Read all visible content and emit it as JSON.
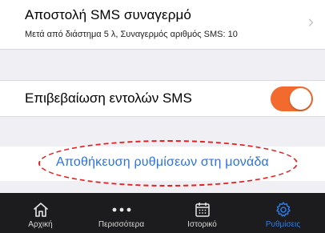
{
  "alarm_sms": {
    "title": "Αποστολή SMS συναγερμό",
    "subtitle": "Μετά από διάστημα 5 λ, Συναγερμός αριθμός SMS: 10",
    "chevron_icon": "chevron-right-icon"
  },
  "confirm_sms": {
    "label": "Επιβεβαίωση εντολών SMS",
    "toggle_on": true,
    "toggle_color": "#f26a2e"
  },
  "save": {
    "label": "Αποθήκευση ρυθμίσεων στη μονάδα",
    "link_color": "#2b72e0",
    "highlight_color": "#e42020"
  },
  "tabbar": {
    "active_color": "#2c7be5",
    "items": [
      {
        "label": "Αρχική",
        "icon": "home-icon"
      },
      {
        "label": "Περισσότερα",
        "icon": "more-dots-icon"
      },
      {
        "label": "Ιστορικό",
        "icon": "calendar-icon"
      },
      {
        "label": "Ρυθμίσεις",
        "icon": "gear-icon",
        "active": true
      }
    ]
  }
}
